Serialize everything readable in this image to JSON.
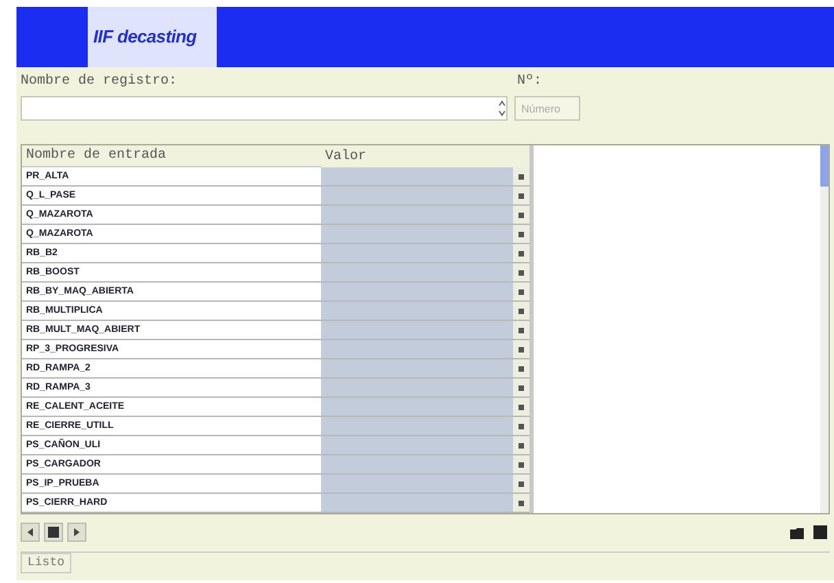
{
  "header": {
    "logo": "IIF decasting"
  },
  "registry": {
    "label": "Nombre de registro:",
    "number_label": "Nº:",
    "number_placeholder": "Número"
  },
  "table": {
    "columns": [
      "Nombre de entrada",
      "Valor"
    ],
    "rows": [
      {
        "name": "PR_ALTA"
      },
      {
        "name": "Q_L_PASE"
      },
      {
        "name": "Q_MAZAROTA"
      },
      {
        "name": "Q_MAZAROTA"
      },
      {
        "name": "RB_B2"
      },
      {
        "name": "RB_BOOST"
      },
      {
        "name": "RB_BY_MAQ_ABIERTA"
      },
      {
        "name": "RB_MULTIPLICA"
      },
      {
        "name": "RB_MULT_MAQ_ABIERT"
      },
      {
        "name": "RP_3_PROGRESIVA"
      },
      {
        "name": "RD_RAMPA_2"
      },
      {
        "name": "RD_RAMPA_3"
      },
      {
        "name": "RE_CALENT_ACEITE"
      },
      {
        "name": "RE_CIERRE_UTILL"
      },
      {
        "name": "PS_CAÑON_ULI"
      },
      {
        "name": "PS_CARGADOR"
      },
      {
        "name": "PS_IP_PRUEBA"
      },
      {
        "name": "PS_CIERR_HARD"
      }
    ]
  },
  "status_bar": {
    "text": "Listo"
  }
}
